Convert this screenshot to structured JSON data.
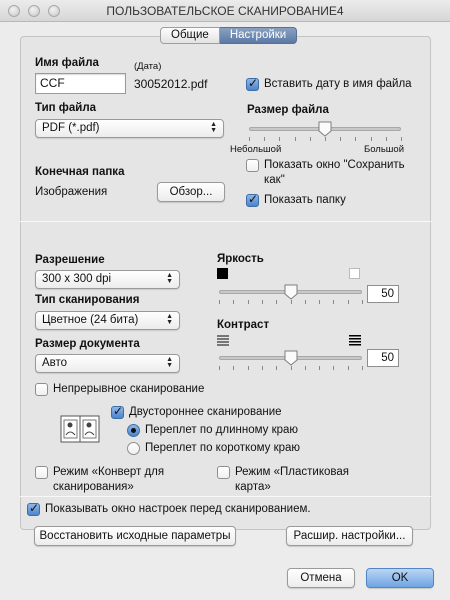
{
  "window": {
    "title": "ПОЛЬЗОВАТЕЛЬСКОЕ СКАНИРОВАНИЕ4"
  },
  "tabs": [
    {
      "label": "Общие",
      "active": false
    },
    {
      "label": "Настройки",
      "active": true
    }
  ],
  "file_name": {
    "label": "Имя файла",
    "value": "CCF",
    "date_caption": "(Дата)",
    "date_suffix": "30052012.pdf",
    "insert_date": {
      "label": "Вставить дату в имя файла",
      "checked": true
    }
  },
  "file_type": {
    "label": "Тип файла",
    "value": "PDF (*.pdf)"
  },
  "file_size": {
    "label": "Размер файла",
    "min_label": "Небольшой",
    "max_label": "Большой",
    "level": 0.5
  },
  "show_save_window": {
    "label_line1": "Показать окно \"Сохранить",
    "label_line2": "как\"",
    "checked": false
  },
  "destination": {
    "label": "Конечная папка",
    "folder": "Изображения",
    "browse_label": "Обзор..."
  },
  "show_folder": {
    "label": "Показать папку",
    "checked": true
  },
  "resolution": {
    "label": "Разрешение",
    "value": "300 x 300  dpi"
  },
  "scan_type": {
    "label": "Тип сканирования",
    "value": "Цветное (24 бита)"
  },
  "document_size": {
    "label": "Размер документа",
    "value": "Авто"
  },
  "brightness": {
    "label": "Яркость",
    "value": "50",
    "level": 0.5
  },
  "contrast": {
    "label": "Контраст",
    "value": "50",
    "level": 0.5
  },
  "continuous_scan": {
    "label": "Непрерывное сканирование",
    "checked": false
  },
  "duplex": {
    "label": "Двустороннее сканирование",
    "checked": true,
    "options": [
      {
        "label": "Переплет по длинному краю",
        "selected": true
      },
      {
        "label": "Переплет по короткому краю",
        "selected": false
      }
    ]
  },
  "envelope_mode": {
    "label_line1": "Режим «Конверт для",
    "label_line2": "сканирования»",
    "checked": false
  },
  "plastic_card_mode": {
    "label_line1": "Режим «Пластиковая",
    "label_line2": "карта»",
    "checked": false
  },
  "show_settings": {
    "label": "Показывать окно настроек перед сканированием.",
    "checked": true
  },
  "buttons": {
    "restore": "Восстановить исходные параметры",
    "advanced": "Расшир. настройки...",
    "cancel": "Отмена",
    "ok": "OK"
  }
}
